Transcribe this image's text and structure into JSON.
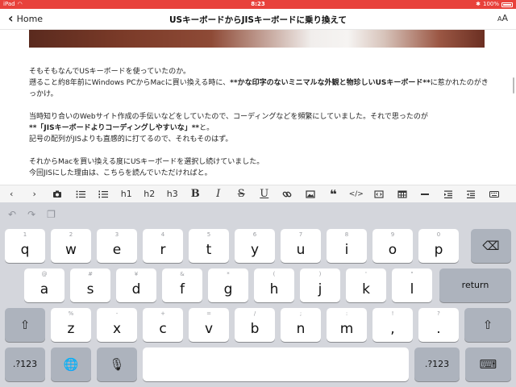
{
  "status_bar": {
    "device": "iPad",
    "time": "8:23",
    "battery": "100%"
  },
  "nav": {
    "back_label": "Home",
    "title": "USキーボードからJISキーボードに乗り換えて",
    "aa_label": "AA"
  },
  "article": {
    "p1_a": "そもそもなんでUSキーボードを使っていたのか。",
    "p1_b": "遡ること約8年前にWindows PCからMacに買い換える時に、",
    "p1_c": "**かな印字のないミニマルな外観と物珍しいUSキーボード**",
    "p1_d": "に惹かれたのがきっかけ。",
    "p2_a": "当時知り合いのWebサイト作成の手伝いなどをしていたので、コーディングなどを頻繁にしていました。それで思ったのが",
    "p2_b": "**「JISキーボードよりコーディングしやすいな」**",
    "p2_c": "と。",
    "p2_d": "記号の配列がJISよりも直感的に打てるので、それもそのはず。",
    "p3_a": "それからMacを買い換える度にUSキーボードを選択し続けていました。",
    "p3_b": "今回JISにした理由は、こちらを読んでいただければと。"
  },
  "toolbar": {
    "h1": "h1",
    "h2": "h2",
    "h3": "h3",
    "bold": "B",
    "italic": "I",
    "strike": "S",
    "underline": "U"
  },
  "keyboard": {
    "row1": [
      {
        "hint": "1",
        "key": "q"
      },
      {
        "hint": "2",
        "key": "w"
      },
      {
        "hint": "3",
        "key": "e"
      },
      {
        "hint": "4",
        "key": "r"
      },
      {
        "hint": "5",
        "key": "t"
      },
      {
        "hint": "6",
        "key": "y"
      },
      {
        "hint": "7",
        "key": "u"
      },
      {
        "hint": "8",
        "key": "i"
      },
      {
        "hint": "9",
        "key": "o"
      },
      {
        "hint": "0",
        "key": "p"
      }
    ],
    "row2": [
      {
        "hint": "@",
        "key": "a"
      },
      {
        "hint": "#",
        "key": "s"
      },
      {
        "hint": "¥",
        "key": "d"
      },
      {
        "hint": "&",
        "key": "f"
      },
      {
        "hint": "*",
        "key": "g"
      },
      {
        "hint": "(",
        "key": "h"
      },
      {
        "hint": ")",
        "key": "j"
      },
      {
        "hint": "'",
        "key": "k"
      },
      {
        "hint": "\"",
        "key": "l"
      }
    ],
    "row3": [
      {
        "hint": "%",
        "key": "z"
      },
      {
        "hint": "-",
        "key": "x"
      },
      {
        "hint": "+",
        "key": "c"
      },
      {
        "hint": "=",
        "key": "v"
      },
      {
        "hint": "/",
        "key": "b"
      },
      {
        "hint": ";",
        "key": "n"
      },
      {
        "hint": ":",
        "key": "m"
      },
      {
        "hint": "!",
        "key": ","
      },
      {
        "hint": "?",
        "key": "."
      }
    ],
    "return_label": "return",
    "numbers_label": ".?123",
    "icons": {
      "backspace": "backspace-icon",
      "shift": "shift-icon",
      "globe": "globe-icon",
      "mic": "microphone-icon",
      "dismiss": "keyboard-dismiss-icon"
    }
  },
  "colors": {
    "status_bar": "#e8413b",
    "keyboard_bg": "#d4d6dc",
    "dark_key": "#adb3bd"
  }
}
